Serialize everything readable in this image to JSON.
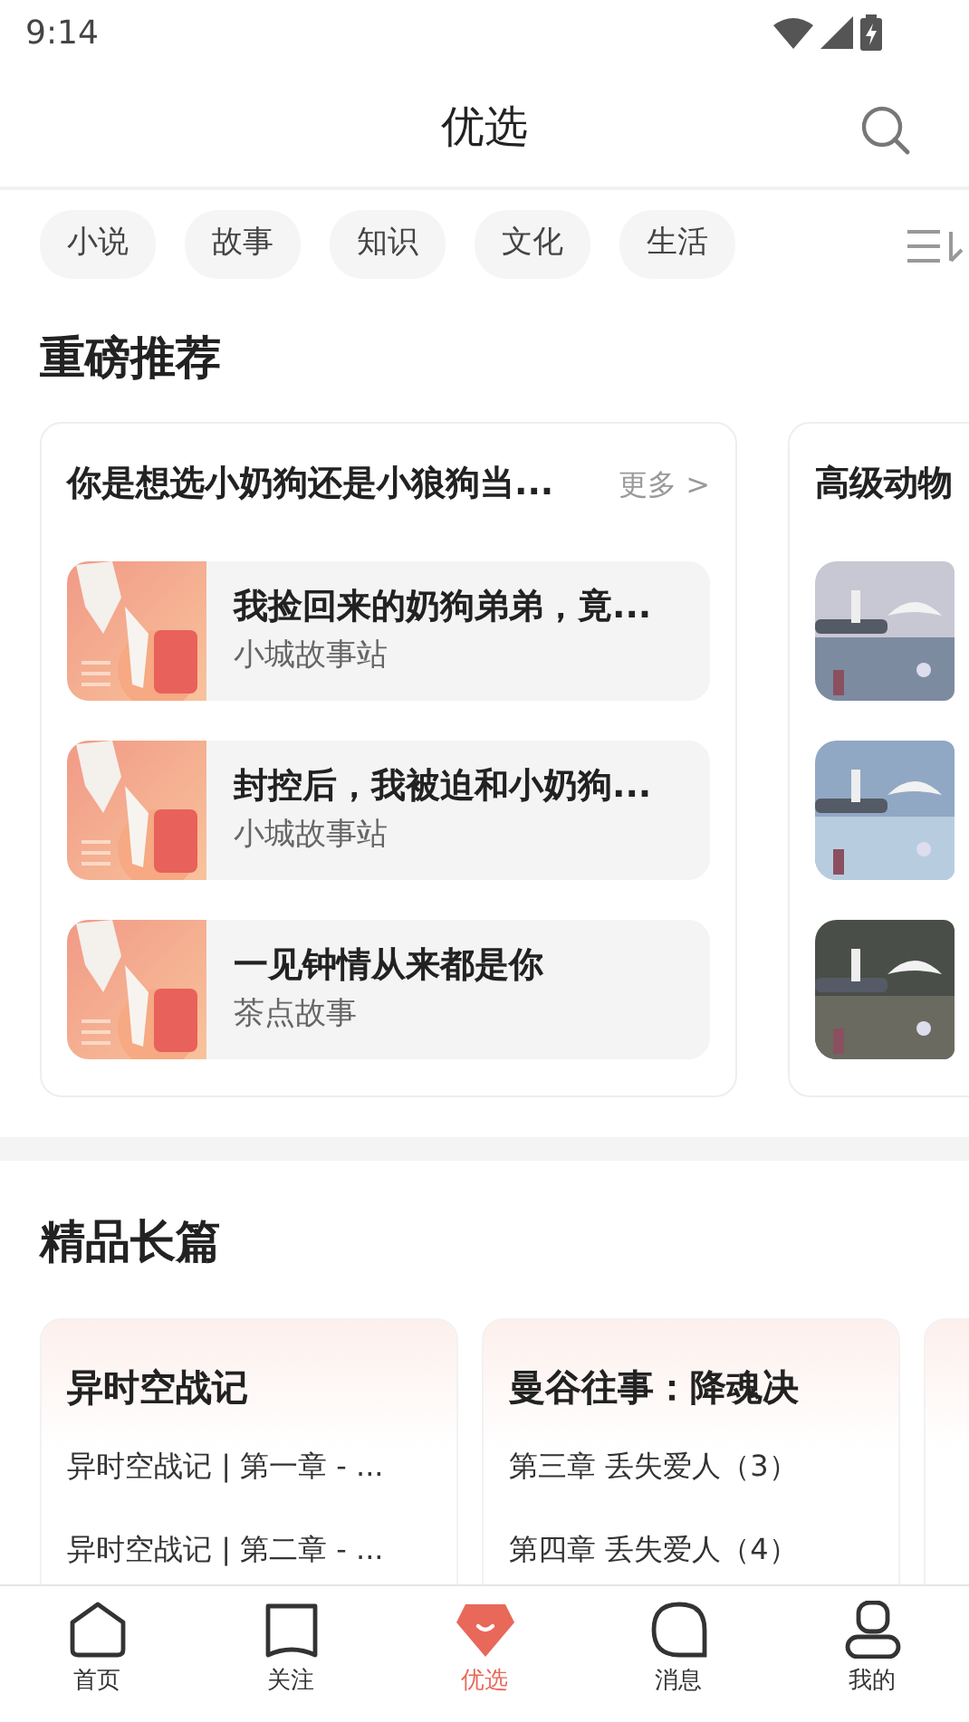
{
  "status_bar": {
    "time": "9:14"
  },
  "header": {
    "title": "优选"
  },
  "chips": [
    {
      "label": "小说"
    },
    {
      "label": "故事"
    },
    {
      "label": "知识"
    },
    {
      "label": "文化"
    },
    {
      "label": "生活"
    }
  ],
  "featured": {
    "title": "重磅推荐",
    "cards": [
      {
        "title": "你是想选小奶狗还是小狼狗当...",
        "more": "更多 >",
        "items": [
          {
            "kind": "cover",
            "title": "我捡回来的奶狗弟弟，竟...",
            "author": "小城故事站"
          },
          {
            "kind": "cover",
            "title": "封控后，我被迫和小奶狗...",
            "author": "小城故事站"
          },
          {
            "kind": "cover",
            "title": "一见钟情从来都是你",
            "author": "茶点故事"
          }
        ]
      },
      {
        "title": "高级动物"
      }
    ]
  },
  "longform": {
    "title": "精品长篇",
    "cards": [
      {
        "kind": "novel",
        "title": "异时空战记",
        "chapters": [
          "异时空战记 | 第一章 - ...",
          "异时空战记 | 第二章 - ..."
        ]
      },
      {
        "kind": "novel",
        "title": "曼谷往事：降魂决",
        "chapters": [
          "第三章 丢失爱人（3）",
          "第四章 丢失爱人（4）"
        ]
      },
      {
        "kind": "cut"
      }
    ]
  },
  "bottom_nav": [
    {
      "label": "首页",
      "selected": false
    },
    {
      "label": "关注",
      "selected": false
    },
    {
      "label": "优选",
      "selected": true
    },
    {
      "label": "消息",
      "selected": false
    },
    {
      "label": "我的",
      "selected": false
    }
  ]
}
